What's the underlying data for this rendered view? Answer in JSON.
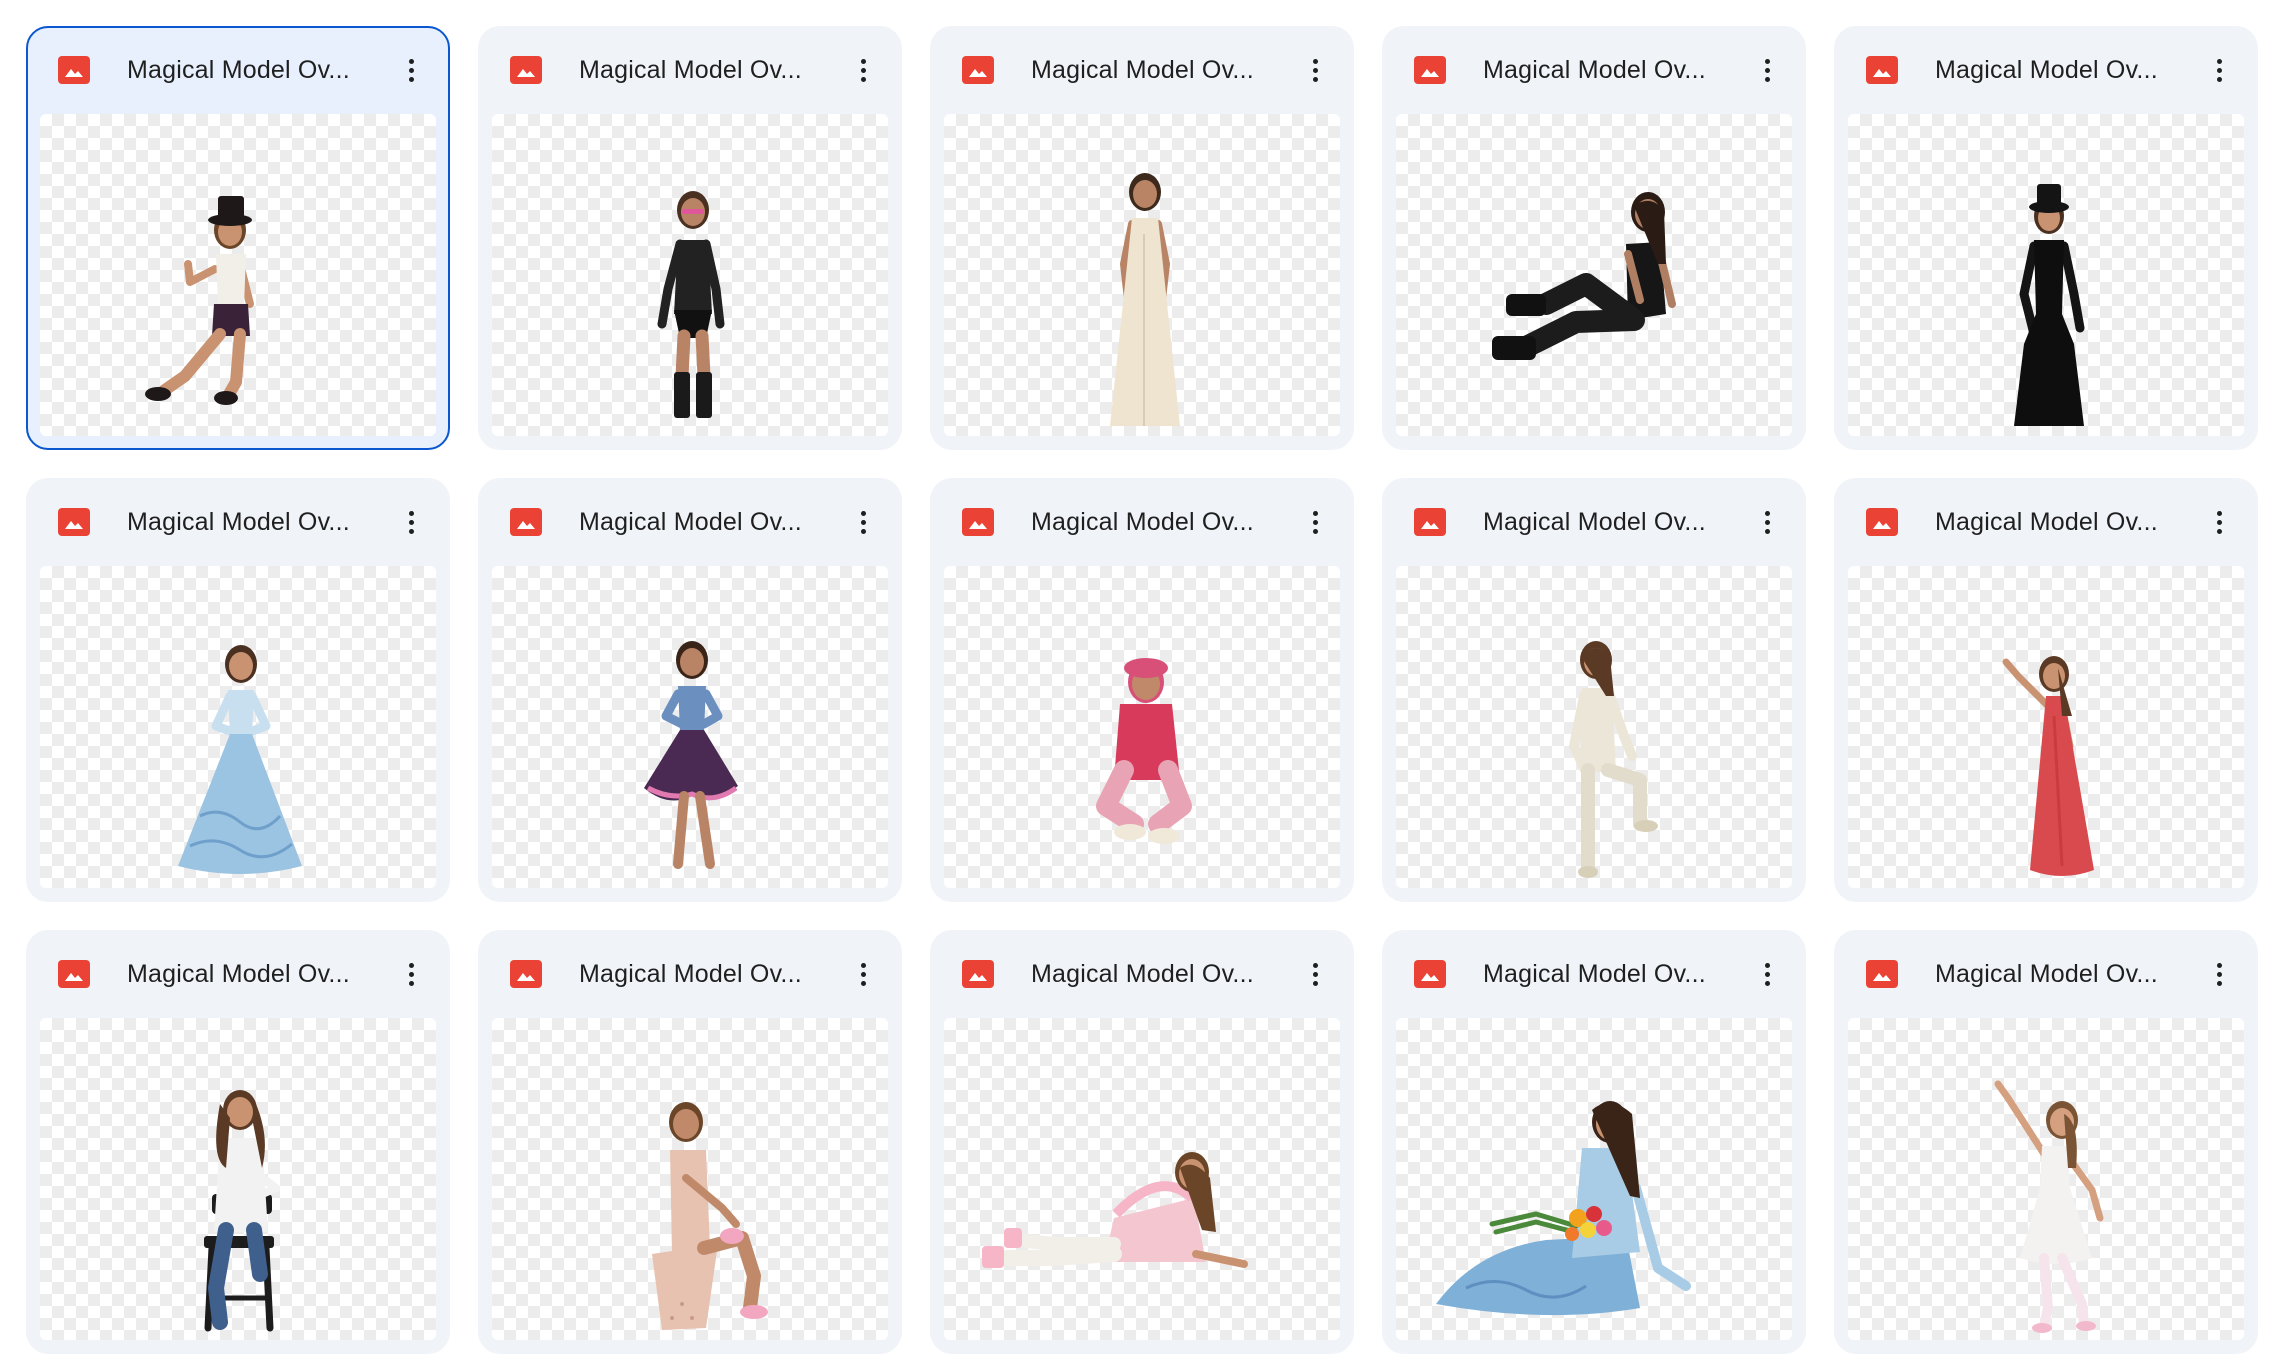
{
  "files": [
    {
      "name": "Magical Model Ov...",
      "selected": true,
      "pose": "kick-hat",
      "colors": {
        "skin": "#c99270",
        "top": "#f2eee8",
        "bottom": "#3a2238",
        "hair": "#6a4528",
        "accent": "#1e1818"
      }
    },
    {
      "name": "Magical Model Ov...",
      "selected": false,
      "pose": "stand-boots",
      "colors": {
        "skin": "#b98466",
        "top": "#222222",
        "bottom": "#111111",
        "hair": "#4a3020",
        "accent": "#e0569a"
      }
    },
    {
      "name": "Magical Model Ov...",
      "selected": false,
      "pose": "long-dress",
      "colors": {
        "skin": "#b98466",
        "top": "#efe4cf",
        "bottom": "#efe4cf",
        "hair": "#3e2a1c",
        "accent": "#d8ccb4"
      }
    },
    {
      "name": "Magical Model Ov...",
      "selected": false,
      "pose": "sit-recline",
      "colors": {
        "skin": "#b07e62",
        "top": "#161616",
        "bottom": "#1c1c1c",
        "hair": "#2a1c14",
        "accent": "#333333"
      }
    },
    {
      "name": "Magical Model Ov...",
      "selected": false,
      "pose": "black-gown-hat",
      "colors": {
        "skin": "#c99270",
        "top": "#141414",
        "bottom": "#0e0e0e",
        "hair": "#4a3020",
        "accent": "#141414"
      }
    },
    {
      "name": "Magical Model Ov...",
      "selected": false,
      "pose": "ball-gown",
      "colors": {
        "skin": "#c99270",
        "top": "#c8dff0",
        "bottom": "#9bc3e2",
        "hair": "#4a3020",
        "accent": "#6f9fcb"
      }
    },
    {
      "name": "Magical Model Ov...",
      "selected": false,
      "pose": "short-skirt",
      "colors": {
        "skin": "#b98466",
        "top": "#6b8fbf",
        "bottom": "#4a2a52",
        "hair": "#3a2418",
        "accent": "#e07ab0"
      }
    },
    {
      "name": "Magical Model Ov...",
      "selected": false,
      "pose": "crouch",
      "colors": {
        "skin": "#c08a6a",
        "top": "#d83a5c",
        "bottom": "#e8a4b4",
        "hair": "#d85078",
        "accent": "#f0e8d8"
      }
    },
    {
      "name": "Magical Model Ov...",
      "selected": false,
      "pose": "knee-up-suit",
      "colors": {
        "skin": "#c99270",
        "top": "#ece6d8",
        "bottom": "#e2dccc",
        "hair": "#5a3a24",
        "accent": "#cfc6b2"
      }
    },
    {
      "name": "Magical Model Ov...",
      "selected": false,
      "pose": "red-dress-reach",
      "colors": {
        "skin": "#c99270",
        "top": "#e25a5a",
        "bottom": "#d94a4e",
        "hair": "#5a3a24",
        "accent": "#c83c40"
      }
    },
    {
      "name": "Magical Model Ov...",
      "selected": false,
      "pose": "chair-sit",
      "colors": {
        "skin": "#c99270",
        "top": "#f2f2f2",
        "bottom": "#3f5f8c",
        "hair": "#5a3a24",
        "accent": "#1c1c1c"
      }
    },
    {
      "name": "Magical Model Ov...",
      "selected": false,
      "pose": "seated-knee",
      "colors": {
        "skin": "#c08a6a",
        "top": "#e8c2b0",
        "bottom": "#e8c2b0",
        "hair": "#6a4528",
        "accent": "#f2a6c0"
      }
    },
    {
      "name": "Magical Model Ov...",
      "selected": false,
      "pose": "lying-side",
      "colors": {
        "skin": "#c99270",
        "top": "#f4c6d0",
        "bottom": "#f2d8dc",
        "hair": "#6a4528",
        "accent": "#f6b6c8"
      }
    },
    {
      "name": "Magical Model Ov...",
      "selected": false,
      "pose": "flowers-floor",
      "colors": {
        "skin": "#c99270",
        "top": "#a8cce6",
        "bottom": "#7fb0d8",
        "hair": "#3a2418",
        "accent": "#f2a21c"
      }
    },
    {
      "name": "Magical Model Ov...",
      "selected": false,
      "pose": "white-dress-step",
      "colors": {
        "skin": "#d4a080",
        "top": "#f4f2f0",
        "bottom": "#ecebe8",
        "hair": "#7a5434",
        "accent": "#f2b8cc"
      }
    }
  ]
}
